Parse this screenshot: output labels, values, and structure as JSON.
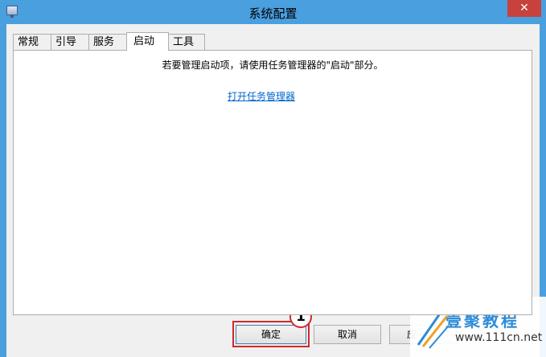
{
  "window": {
    "title": "系统配置",
    "close_label": "✕"
  },
  "tabs": [
    {
      "label": "常规",
      "active": false
    },
    {
      "label": "引导",
      "active": false
    },
    {
      "label": "服务",
      "active": false
    },
    {
      "label": "启动",
      "active": true
    },
    {
      "label": "工具",
      "active": false
    }
  ],
  "startup_panel": {
    "instruction": "若要管理启动项，请使用任务管理器的\"启动\"部分。",
    "link_label": "打开任务管理器"
  },
  "buttons": {
    "ok_label": "确定",
    "cancel_label": "取消",
    "apply_label": "应"
  },
  "annotation": {
    "step_number": "1",
    "highlight_color": "#d3282b"
  },
  "watermark": {
    "brand": "壹聚教程",
    "url": "www.111cn.net"
  },
  "colors": {
    "frame": "#4a9fde",
    "close": "#c7423c",
    "link": "#0066cc"
  }
}
